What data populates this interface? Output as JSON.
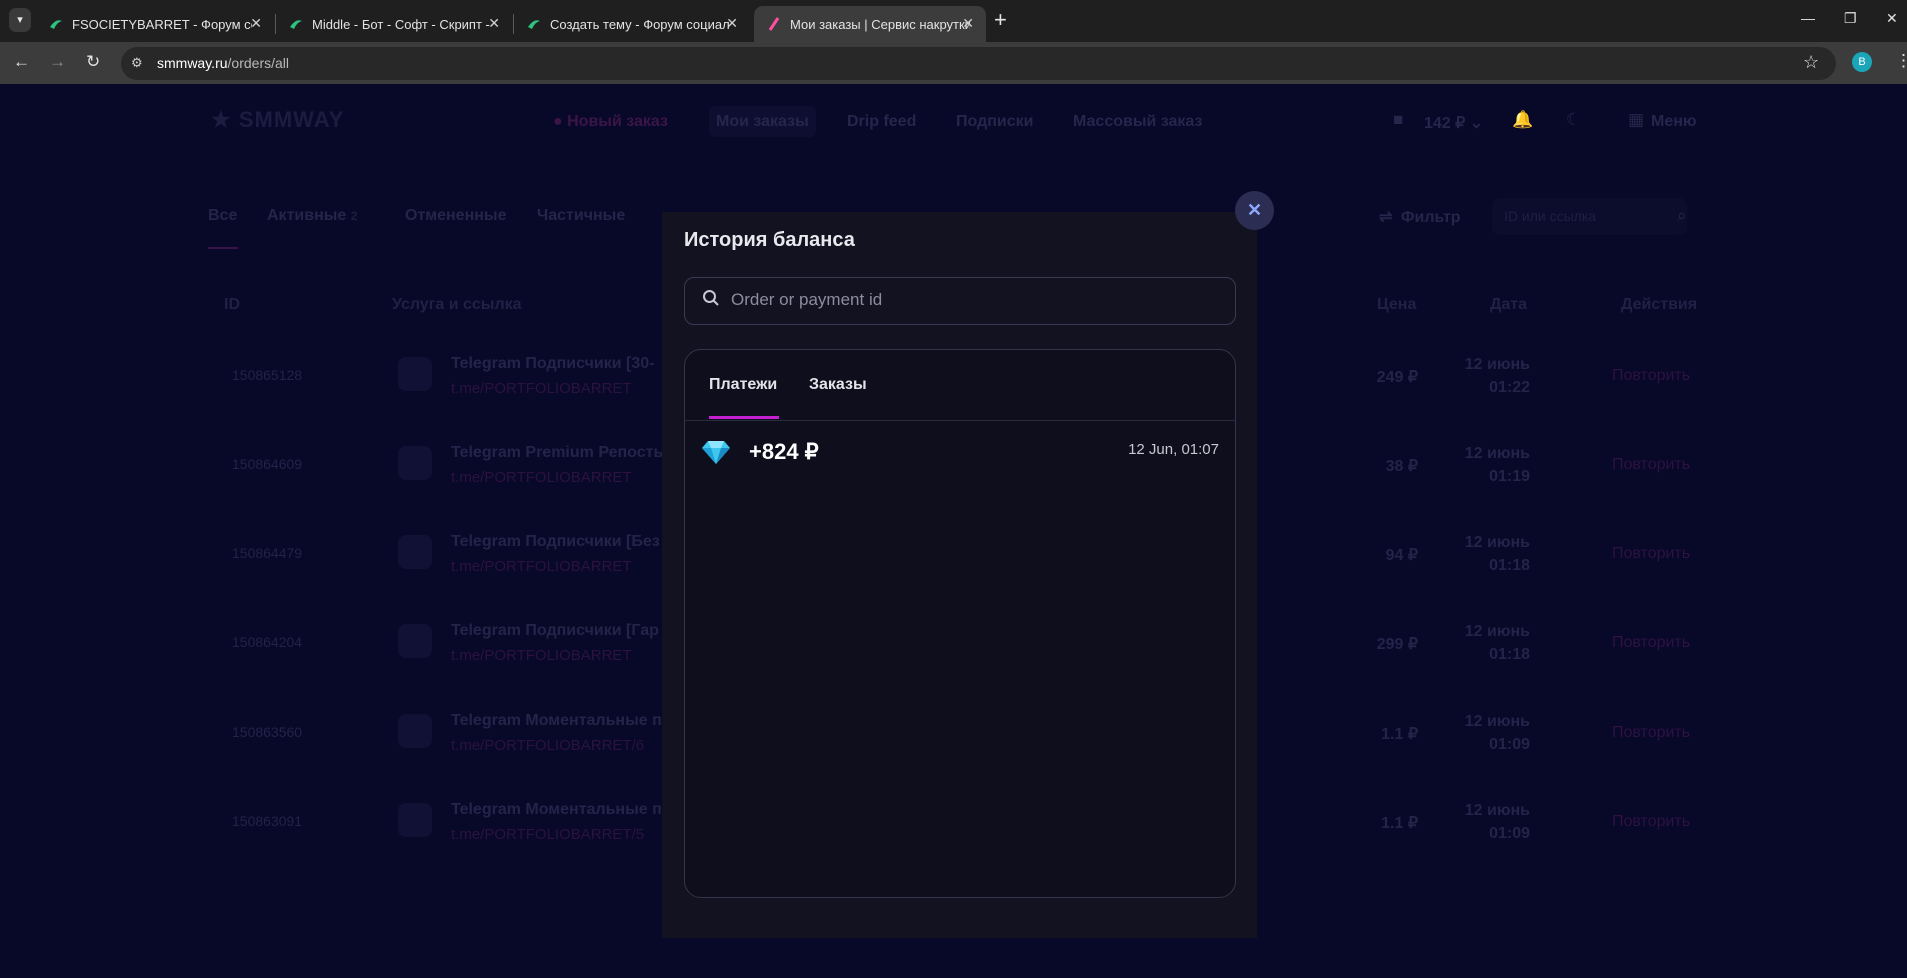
{
  "browser": {
    "tabs": [
      {
        "title": "FSOCIETYBARRET - Форум социальной",
        "favicon": "forum-icon"
      },
      {
        "title": "Middle - Бот - Софт - Скрипт - ",
        "favicon": "forum-icon"
      },
      {
        "title": "Создать тему - Форум социальн",
        "favicon": "forum-icon"
      },
      {
        "title": "Мои заказы | Сервис накрутки",
        "favicon": "smmway-icon",
        "active": true
      }
    ],
    "url_host": "smmway.ru",
    "url_path": "/orders/all",
    "profile_initial": "B"
  },
  "header": {
    "logo": "SMMWAY",
    "nav": [
      "Новый заказ",
      "Мои заказы",
      "Drip feed",
      "Подписки",
      "Массовый заказ"
    ],
    "balance": "142 ₽",
    "menu_label": "Меню"
  },
  "filters": {
    "tabs": [
      "Все",
      "Активные",
      "Отмененные",
      "Частичные"
    ],
    "active_count": "2",
    "filter_label": "Фильтр",
    "search_placeholder": "ID или ссылка"
  },
  "table": {
    "columns": [
      "ID",
      "Услуга и ссылка",
      "Цена",
      "Дата",
      "Действия"
    ],
    "rows": [
      {
        "id": "150865128",
        "title": "Telegram Подписчики [30-",
        "link": "t.me/PORTFOLIOBARRET",
        "price": "249 ₽",
        "date1": "12 июнь",
        "date2": "01:22",
        "action": "Повторить"
      },
      {
        "id": "150864609",
        "title": "Telegram Premium Репость",
        "link": "t.me/PORTFOLIOBARRET",
        "price": "38 ₽",
        "date1": "12 июнь",
        "date2": "01:19",
        "action": "Повторить"
      },
      {
        "id": "150864479",
        "title": "Telegram Подписчики [Без",
        "link": "t.me/PORTFOLIOBARRET",
        "price": "94 ₽",
        "date1": "12 июнь",
        "date2": "01:18",
        "action": "Повторить"
      },
      {
        "id": "150864204",
        "title": "Telegram Подписчики [Гар",
        "link": "t.me/PORTFOLIOBARRET",
        "price": "299 ₽",
        "date1": "12 июнь",
        "date2": "01:18",
        "action": "Повторить"
      },
      {
        "id": "150863560",
        "title": "Telegram Моментальные п",
        "link": "t.me/PORTFOLIOBARRET/6",
        "price": "1.1 ₽",
        "date1": "12 июнь",
        "date2": "01:09",
        "action": "Повторить"
      },
      {
        "id": "150863091",
        "title": "Telegram Моментальные п",
        "link": "t.me/PORTFOLIOBARRET/5",
        "price": "1.1 ₽",
        "date1": "12 июнь",
        "date2": "01:09",
        "action": "Повторить"
      }
    ]
  },
  "modal": {
    "title": "История баланса",
    "search_placeholder": "Order or payment id",
    "tabs": [
      "Платежи",
      "Заказы"
    ],
    "entries": [
      {
        "icon": "diamond-icon",
        "amount": "+824 ₽",
        "date": "12 Jun, 01:07"
      }
    ]
  }
}
